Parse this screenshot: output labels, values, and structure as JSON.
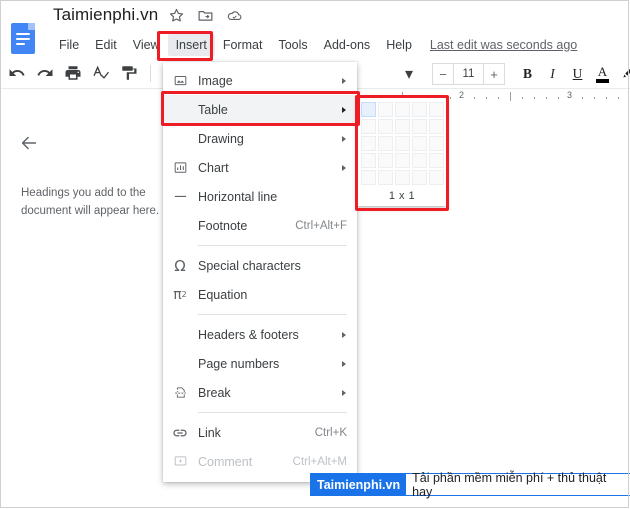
{
  "header": {
    "doc_title": "Taimienphi.vn",
    "title_icons": [
      {
        "name": "star-icon",
        "glyph": "star"
      },
      {
        "name": "move-to-folder-icon",
        "glyph": "folder"
      },
      {
        "name": "cloud-saved-icon",
        "glyph": "cloud"
      }
    ],
    "menus": [
      "File",
      "Edit",
      "View",
      "Insert",
      "Format",
      "Tools",
      "Add-ons",
      "Help"
    ],
    "active_menu": "Insert",
    "last_edit": "Last edit was seconds ago"
  },
  "toolbar": {
    "left_icons": [
      {
        "name": "undo-icon"
      },
      {
        "name": "redo-icon"
      },
      {
        "name": "print-icon"
      },
      {
        "name": "spelling-check-icon"
      },
      {
        "name": "paint-format-icon"
      }
    ],
    "zoom_caret": "▾",
    "font_size_decrease": "−",
    "font_size": "11",
    "font_size_increase": "+",
    "bold": "B",
    "italic": "I",
    "underline": "U",
    "text_color": "A",
    "highlight": "highlight-pen-icon"
  },
  "ruler": {
    "labels": [
      "2",
      "3"
    ]
  },
  "outline": {
    "back_label": "back-arrow",
    "hint": "Headings you add to the document will appear here."
  },
  "insert_menu": {
    "items": [
      {
        "label": "Image",
        "icon": "image-icon",
        "arrow": true,
        "shortcut": "",
        "disabled": false,
        "highlighted": false
      },
      {
        "label": "Table",
        "icon": "",
        "arrow": true,
        "shortcut": "",
        "disabled": false,
        "highlighted": true
      },
      {
        "label": "Drawing",
        "icon": "",
        "arrow": true,
        "shortcut": "",
        "disabled": false,
        "highlighted": false
      },
      {
        "label": "Chart",
        "icon": "chart-icon",
        "arrow": true,
        "shortcut": "",
        "disabled": false,
        "highlighted": false
      },
      {
        "label": "Horizontal line",
        "icon": "horizontal-line-icon",
        "arrow": false,
        "shortcut": "",
        "disabled": false,
        "highlighted": false
      },
      {
        "label": "Footnote",
        "icon": "",
        "arrow": false,
        "shortcut": "Ctrl+Alt+F",
        "disabled": false,
        "highlighted": false
      },
      {
        "separator": true
      },
      {
        "label": "Special characters",
        "icon": "omega-icon",
        "arrow": false,
        "shortcut": "",
        "disabled": false,
        "highlighted": false
      },
      {
        "label": "Equation",
        "icon": "pi-icon",
        "arrow": false,
        "shortcut": "",
        "disabled": false,
        "highlighted": false
      },
      {
        "separator": true
      },
      {
        "label": "Headers & footers",
        "icon": "",
        "arrow": true,
        "shortcut": "",
        "disabled": false,
        "highlighted": false
      },
      {
        "label": "Page numbers",
        "icon": "",
        "arrow": true,
        "shortcut": "",
        "disabled": false,
        "highlighted": false
      },
      {
        "label": "Break",
        "icon": "break-icon",
        "arrow": true,
        "shortcut": "",
        "disabled": false,
        "highlighted": false
      },
      {
        "separator": true
      },
      {
        "label": "Link",
        "icon": "link-icon",
        "arrow": false,
        "shortcut": "Ctrl+K",
        "disabled": false,
        "highlighted": false
      },
      {
        "label": "Comment",
        "icon": "comment-icon",
        "arrow": false,
        "shortcut": "Ctrl+Alt+M",
        "disabled": true,
        "highlighted": false
      }
    ]
  },
  "table_picker": {
    "columns": 5,
    "rows": 5,
    "selected_columns": 1,
    "selected_rows": 1,
    "size_label": "1 x 1"
  },
  "watermark": {
    "brand": "Taimienphi.vn",
    "text": "Tải phần mềm miễn phí + thủ thuật hay"
  },
  "annotations": {
    "accent_color": "#ee1c25",
    "boxes": [
      "insert-menu",
      "table-item",
      "table-grid-picker"
    ]
  }
}
